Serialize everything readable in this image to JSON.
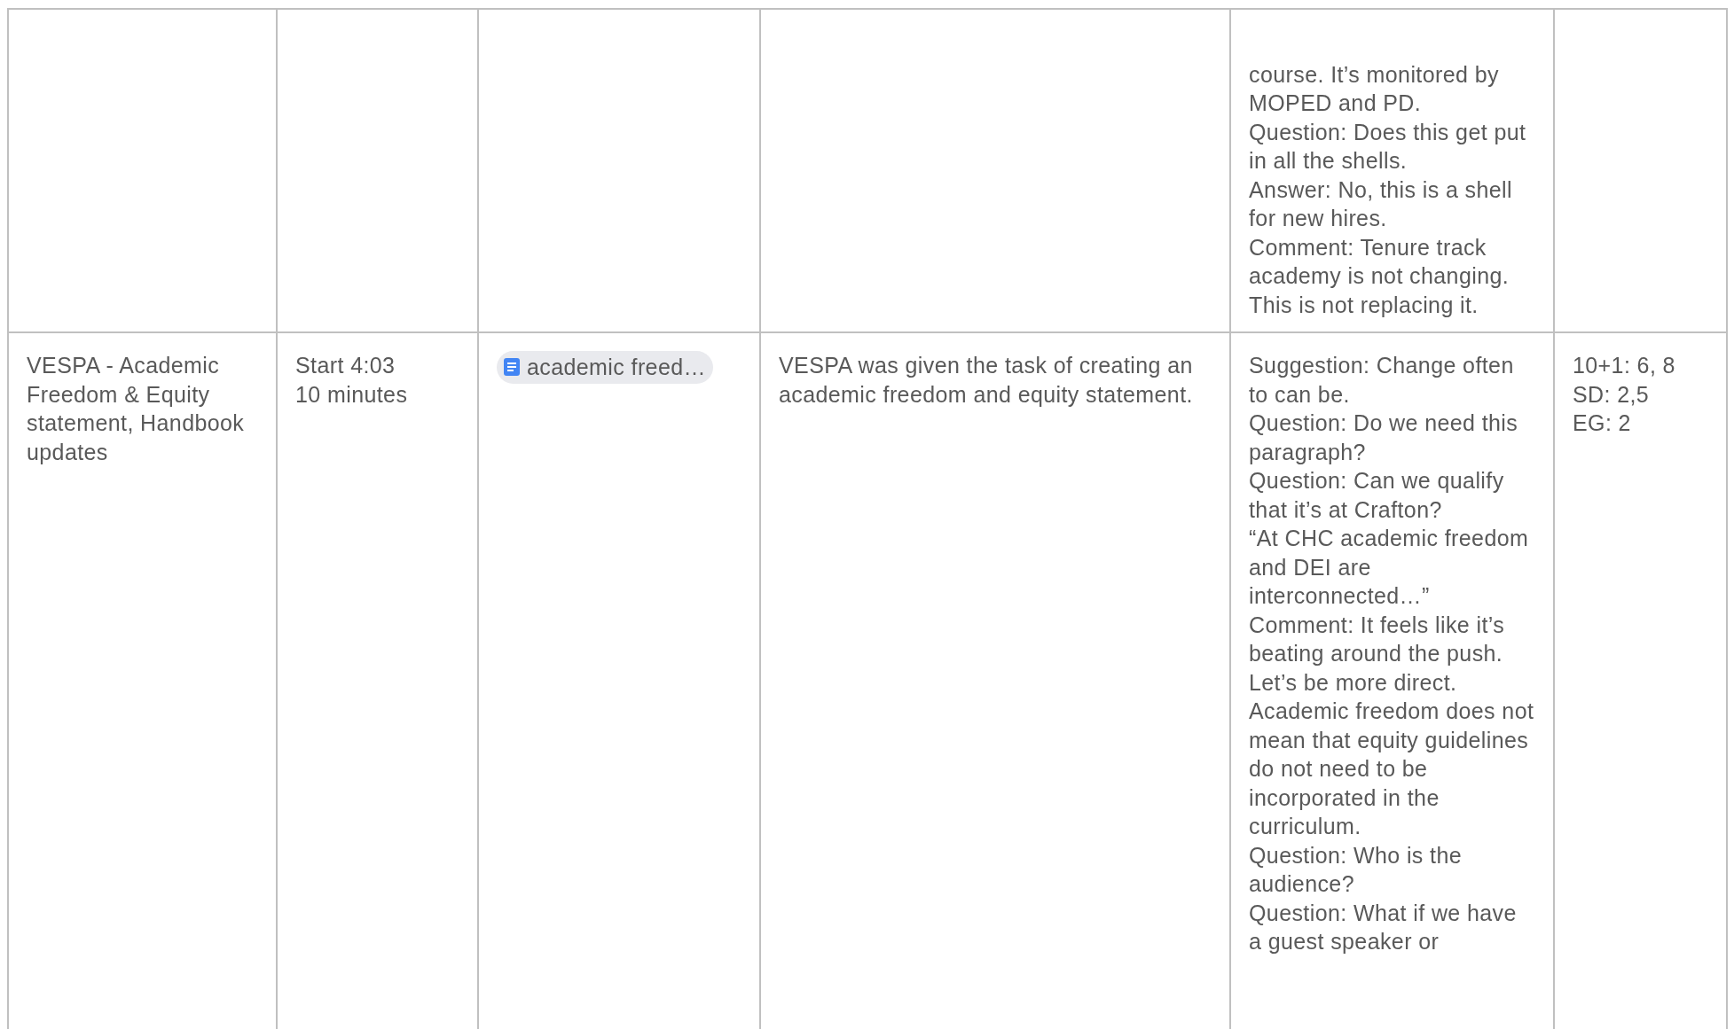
{
  "table": {
    "rows": [
      {
        "column_5": {
          "kind": "text",
          "lines": [
            "course. It’s monitored by MOPED and PD.",
            "Question: Does this get put in all the shells.",
            "Answer: No, this is a shell for new hires.",
            "Comment: Tenure track academy is not changing. This is not replacing it."
          ]
        }
      },
      {
        "column_1": {
          "kind": "text",
          "lines": [
            "VESPA - Academic Freedom & Equity statement, Handbook updates"
          ]
        },
        "column_2": {
          "kind": "text",
          "lines": [
            "Start 4:03",
            "10 minutes"
          ]
        },
        "column_3": {
          "kind": "chip",
          "label": "academic freed…"
        },
        "column_4": {
          "kind": "text",
          "lines": [
            "VESPA was given the task of creating an academic freedom and equity statement."
          ]
        },
        "column_5": {
          "kind": "text",
          "lines": [
            "Suggestion: Change often to can be.",
            "Question: Do we need this paragraph?",
            "Question: Can we qualify that it’s at Crafton?",
            "“At CHC academic freedom and DEI are interconnected…”",
            "Comment: It feels like it’s beating around the push. Let’s be more direct. Academic freedom does not mean that equity guidelines do not need to be incorporated in the curriculum.",
            "Question: Who is the audience?",
            "Question: What if we have a guest speaker or"
          ]
        },
        "column_6": {
          "kind": "text",
          "lines": [
            "10+1: 6, 8",
            "SD: 2,5",
            "EG: 2"
          ]
        }
      }
    ]
  }
}
